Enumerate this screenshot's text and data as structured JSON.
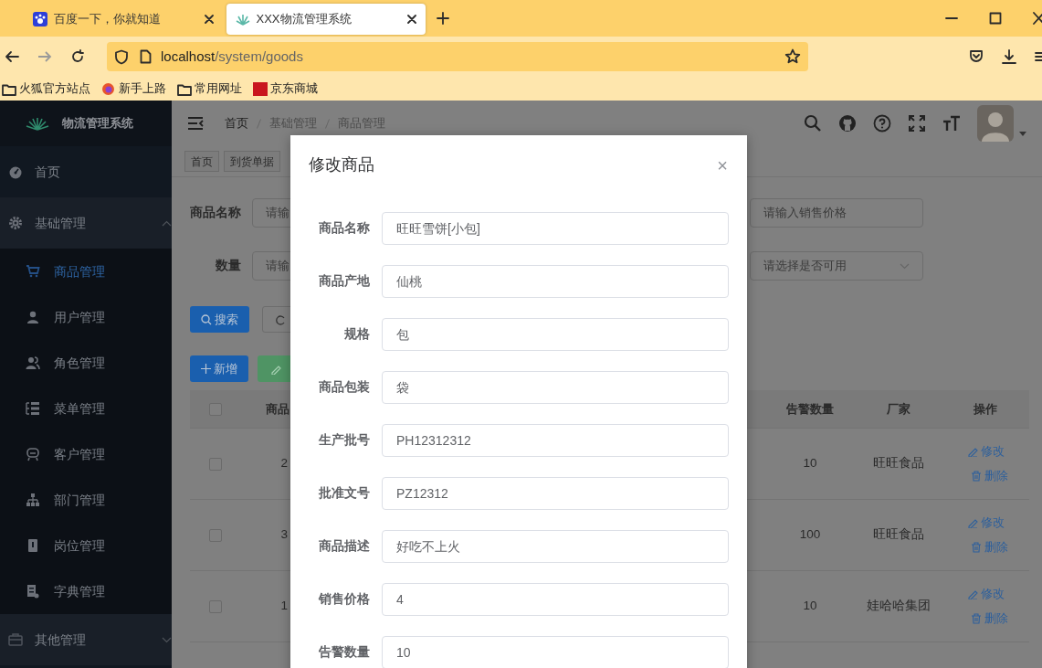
{
  "browser": {
    "tabs": [
      {
        "title": "百度一下，你就知道",
        "selected": false
      },
      {
        "title": "XXX物流管理系统",
        "selected": true
      }
    ],
    "address": {
      "host": "localhost",
      "path": "/system/goods"
    },
    "bookmarks": [
      "火狐官方站点",
      "新手上路",
      "常用网址",
      "京东商城"
    ]
  },
  "sidebar": {
    "title": "物流管理系统",
    "menu": [
      {
        "label": "首页",
        "kind": "item",
        "selected": false
      },
      {
        "label": "基础管理",
        "kind": "group",
        "expanded": true,
        "children": [
          {
            "label": "商品管理",
            "selected": true
          },
          {
            "label": "用户管理",
            "selected": false
          },
          {
            "label": "角色管理",
            "selected": false
          },
          {
            "label": "菜单管理",
            "selected": false
          },
          {
            "label": "客户管理",
            "selected": false
          },
          {
            "label": "部门管理",
            "selected": false
          },
          {
            "label": "岗位管理",
            "selected": false
          },
          {
            "label": "字典管理",
            "selected": false
          }
        ]
      },
      {
        "label": "其他管理",
        "kind": "group",
        "expanded": false
      }
    ]
  },
  "header": {
    "breadcrumb": [
      "首页",
      "基础管理",
      "商品管理"
    ]
  },
  "tags": [
    "首页",
    "到货单据"
  ],
  "search": {
    "fields": [
      {
        "label": "商品名称",
        "placeholder": "请输"
      },
      {
        "label": "数量",
        "placeholder": "请输"
      }
    ],
    "right_fields": [
      {
        "kind": "input",
        "placeholder": "请输入销售价格"
      },
      {
        "kind": "select",
        "placeholder": "请选择是否可用"
      }
    ],
    "search_button": "搜索"
  },
  "toolbar": {
    "add_button": "新增"
  },
  "table": {
    "columns": [
      "商品",
      "告警数量",
      "厂家",
      "操作"
    ],
    "select_all_checked": false,
    "rows": [
      {
        "checked": false,
        "column_2": "2",
        "alert_qty": "10",
        "maker": "旺旺食品",
        "actions": [
          "修改",
          "删除"
        ]
      },
      {
        "checked": false,
        "column_2": "3",
        "alert_qty": "100",
        "maker": "旺旺食品",
        "actions": [
          "修改",
          "删除"
        ]
      },
      {
        "checked": false,
        "column_2": "1",
        "alert_qty": "10",
        "maker": "娃哈哈集团",
        "actions": [
          "修改",
          "删除"
        ]
      }
    ]
  },
  "modal": {
    "title": "修改商品",
    "close": "×",
    "fields": [
      {
        "label": "商品名称",
        "value": "旺旺雪饼[小包]"
      },
      {
        "label": "商品产地",
        "value": "仙桃"
      },
      {
        "label": "规格",
        "value": "包"
      },
      {
        "label": "商品包装",
        "value": "袋"
      },
      {
        "label": "生产批号",
        "value": "PH12312312"
      },
      {
        "label": "批准文号",
        "value": "PZ12312"
      },
      {
        "label": "商品描述",
        "value": "好吃不上火"
      },
      {
        "label": "销售价格",
        "value": "4"
      },
      {
        "label": "告警数量",
        "value": "10"
      }
    ]
  }
}
